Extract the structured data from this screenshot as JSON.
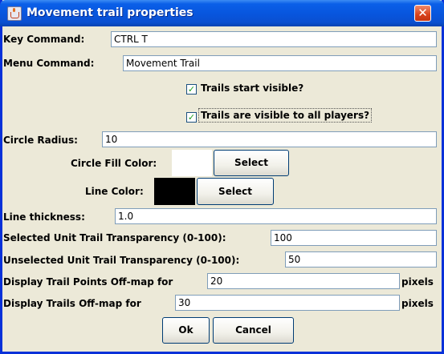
{
  "window": {
    "title": "Movement trail properties"
  },
  "key_command": {
    "label": "Key Command:",
    "value": "CTRL T"
  },
  "menu_command": {
    "label": "Menu Command:",
    "value": "Movement Trail"
  },
  "trails_start_visible": {
    "label": "Trails start visible?",
    "checked": true
  },
  "trails_visible_all": {
    "label": "Trails are visible to all players?",
    "checked": true
  },
  "circle_radius": {
    "label": "Circle Radius:",
    "value": "10"
  },
  "circle_fill": {
    "label": "Circle Fill Color:",
    "color": "#ffffff",
    "button": "Select"
  },
  "line_color": {
    "label": "Line Color:",
    "color": "#000000",
    "button": "Select"
  },
  "line_thickness": {
    "label": "Line thickness:",
    "value": "1.0"
  },
  "selected_transparency": {
    "label": "Selected Unit Trail Transparency (0-100):",
    "value": "100"
  },
  "unselected_transparency": {
    "label": "Unselected Unit Trail Transparency (0-100):",
    "value": "50"
  },
  "points_offmap": {
    "label": "Display Trail Points Off-map for",
    "value": "20",
    "unit": "pixels"
  },
  "trails_offmap": {
    "label": "Display Trails Off-map for",
    "value": "30",
    "unit": "pixels"
  },
  "buttons": {
    "ok": "Ok",
    "cancel": "Cancel"
  },
  "colors": {
    "titlebar": "#0855dd",
    "dialog_bg": "#ece9d8",
    "close": "#d8421c"
  }
}
